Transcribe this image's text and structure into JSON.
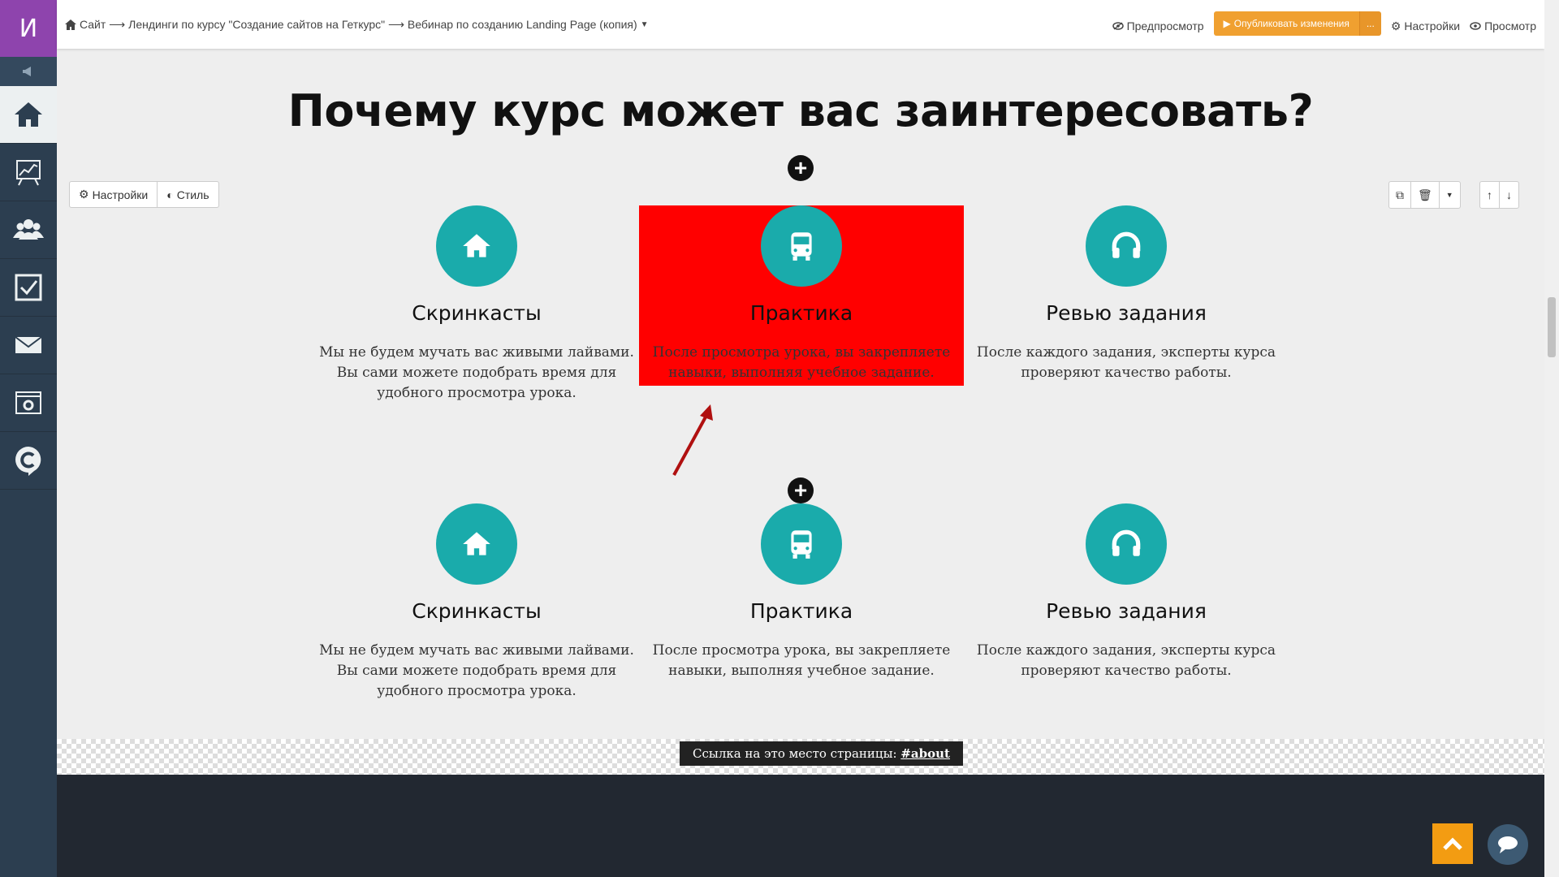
{
  "sidebar": {
    "logo_letter": "И",
    "items": [
      {
        "icon": "home-icon"
      },
      {
        "icon": "chart-icon"
      },
      {
        "icon": "users-icon"
      },
      {
        "icon": "checkbox-icon"
      },
      {
        "icon": "mail-icon"
      },
      {
        "icon": "settings-window-icon"
      },
      {
        "icon": "c-logo-icon"
      }
    ]
  },
  "topbar": {
    "breadcrumb": "Сайт ⟶ Лендинги по курсу \"Создание сайтов на Геткурс\" ⟶ Вебинар по созданию Landing Page (копия)",
    "preview_label": "Предпросмотр",
    "publish_label": "Опубликовать изменения",
    "publish_more": "...",
    "settings_label": "Настройки",
    "view_label": "Просмотр"
  },
  "block_toolbar": {
    "settings_label": "Настройки",
    "style_label": "Стиль"
  },
  "section": {
    "heading": "Почему курс может вас заинтересовать?",
    "row1": [
      {
        "title": "Скринкасты",
        "desc": "Мы не будем мучать вас живыми лайвами. Вы сами можете подобрать время для удобного просмотра урока.",
        "icon": "home-icon"
      },
      {
        "title": "Практика",
        "desc": "После просмотра урока, вы закрепляете навыки, выполняя учебное задание.",
        "icon": "bus-icon"
      },
      {
        "title": "Ревью задания",
        "desc": "После каждого задания, эксперты курса проверяют качество работы.",
        "icon": "headphones-icon"
      }
    ],
    "row2": [
      {
        "title": "Скринкасты",
        "desc": "Мы не будем мучать вас живыми лайвами. Вы сами можете подобрать время для удобного просмотра урока.",
        "icon": "home-icon"
      },
      {
        "title": "Практика",
        "desc": "После просмотра урока, вы закрепляете навыки, выполняя учебное задание.",
        "icon": "bus-icon"
      },
      {
        "title": "Ревью задания",
        "desc": "После каждого задания, эксперты курса проверяют качество работы.",
        "icon": "headphones-icon"
      }
    ]
  },
  "anchor": {
    "label": "Ссылка на это место страницы:",
    "link": "#about"
  },
  "colors": {
    "accent": "#1aabab",
    "highlight": "#ff0000",
    "publish": "#f0a030",
    "sidebar": "#2c3e50",
    "logo": "#8e44ad"
  }
}
